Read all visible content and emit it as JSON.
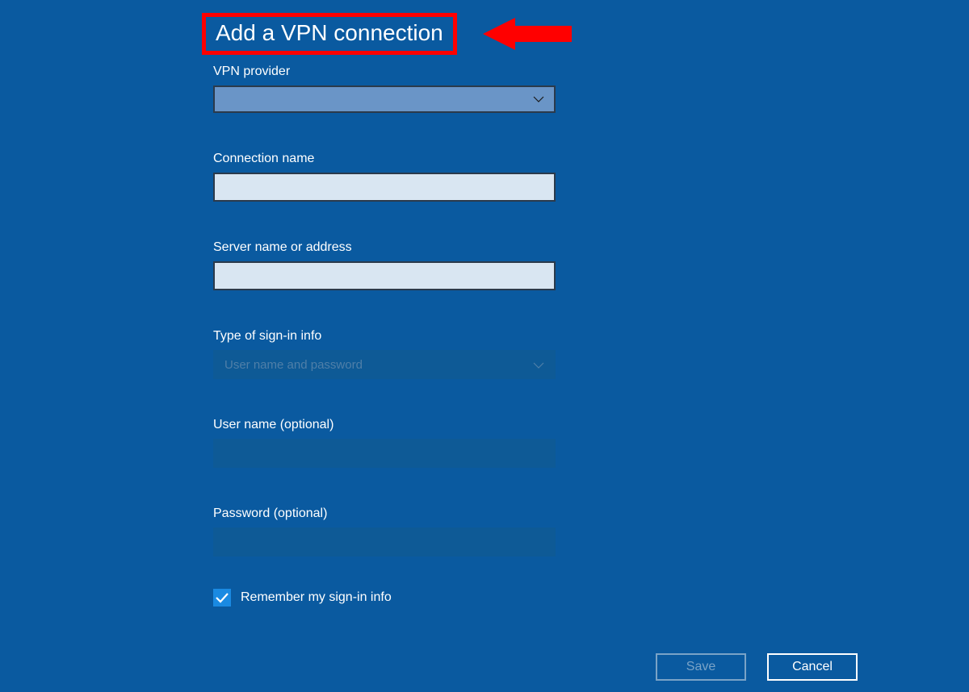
{
  "title": "Add a VPN connection",
  "fields": {
    "vpn_provider": {
      "label": "VPN provider",
      "value": ""
    },
    "connection_name": {
      "label": "Connection name",
      "value": ""
    },
    "server_name": {
      "label": "Server name or address",
      "value": ""
    },
    "sign_in_type": {
      "label": "Type of sign-in info",
      "value": "User name and password"
    },
    "user_name": {
      "label": "User name (optional)",
      "value": ""
    },
    "password": {
      "label": "Password (optional)",
      "value": ""
    }
  },
  "remember": {
    "label": "Remember my sign-in info",
    "checked": true
  },
  "buttons": {
    "save": "Save",
    "cancel": "Cancel"
  }
}
